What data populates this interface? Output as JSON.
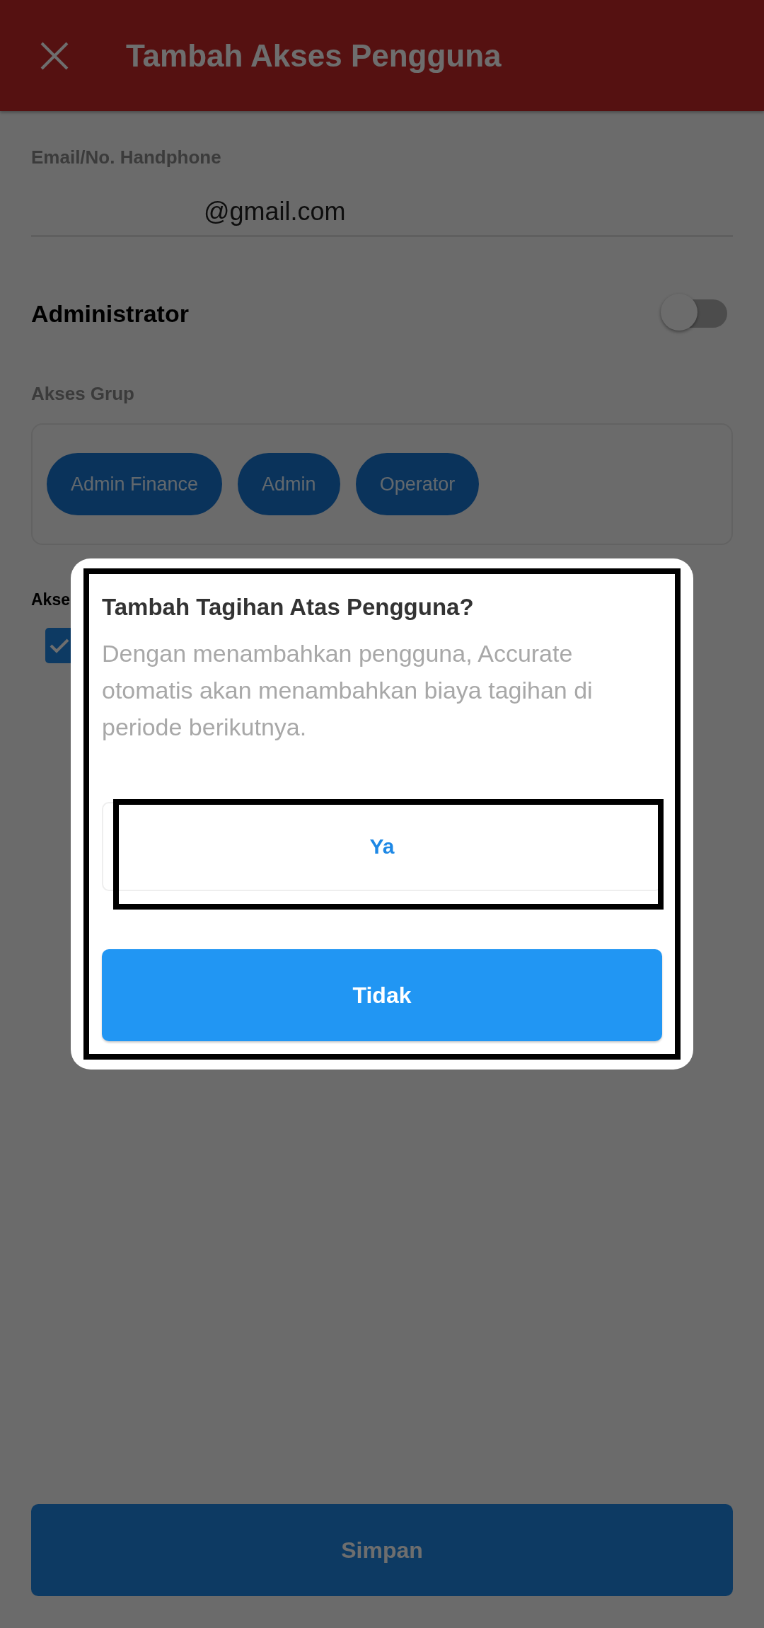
{
  "header": {
    "title": "Tambah Akses Pengguna"
  },
  "email_field": {
    "label": "Email/No. Handphone",
    "value": "@gmail.com"
  },
  "administrator": {
    "label": "Administrator",
    "on": false
  },
  "access_group": {
    "label": "Akses Grup",
    "chips": [
      "Admin Finance",
      "Admin",
      "Operator"
    ]
  },
  "access_section": {
    "label": "Akse",
    "checkbox": {
      "checked": true
    }
  },
  "save_button": "Simpan",
  "dialog": {
    "title": "Tambah Tagihan Atas Pengguna?",
    "message": "Dengan menambahkan pengguna, Accurate otomatis akan menambahkan biaya tagihan di periode berikutnya.",
    "confirm": "Ya",
    "cancel": "Tidak"
  }
}
